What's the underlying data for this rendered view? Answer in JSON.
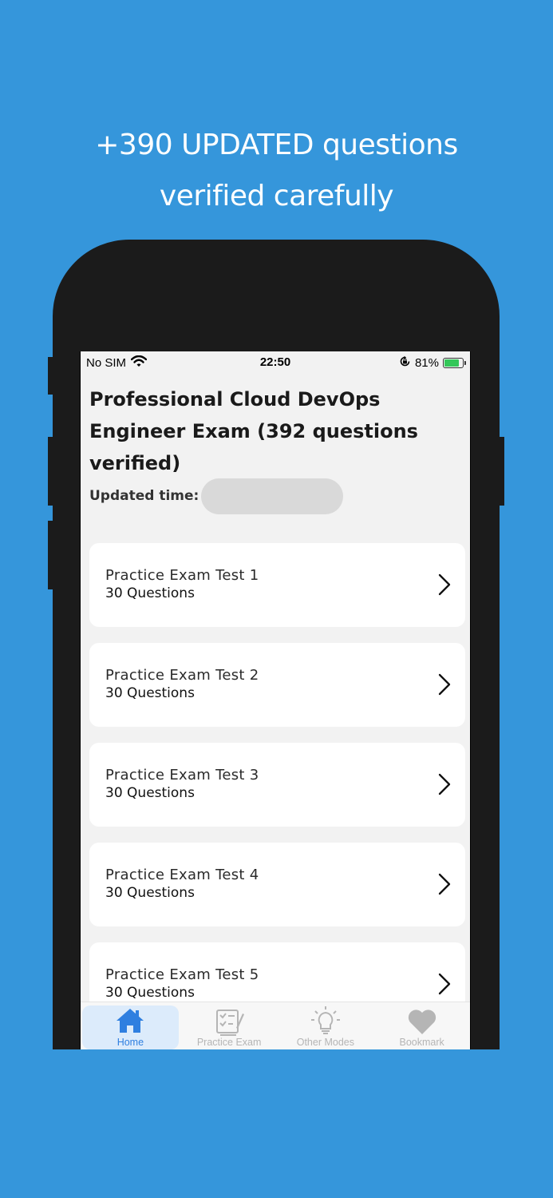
{
  "headline": "+390 UPDATED questions verified carefully",
  "status_bar": {
    "carrier": "No SIM",
    "time": "22:50",
    "battery": "81%",
    "battery_level": 0.81,
    "battery_color": "#34c759"
  },
  "page": {
    "title": "Professional Cloud DevOps Engineer Exam (392 questions verified)",
    "updated_label": "Updated time:"
  },
  "exams": [
    {
      "title": "Practice Exam Test 1",
      "subtitle": "30 Questions"
    },
    {
      "title": "Practice Exam Test 2",
      "subtitle": "30 Questions"
    },
    {
      "title": "Practice Exam Test 3",
      "subtitle": "30 Questions"
    },
    {
      "title": "Practice Exam Test 4",
      "subtitle": "30 Questions"
    },
    {
      "title": "Practice Exam Test 5",
      "subtitle": "30 Questions"
    }
  ],
  "tabs": [
    {
      "label": "Home",
      "icon": "home-icon",
      "active": true
    },
    {
      "label": "Practice Exam",
      "icon": "exam-icon",
      "active": false
    },
    {
      "label": "Other Modes",
      "icon": "lightbulb-icon",
      "active": false
    },
    {
      "label": "Bookmark",
      "icon": "heart-icon",
      "active": false
    }
  ],
  "colors": {
    "background": "#3596db",
    "active_tab": "#2f7fe0",
    "inactive_tab": "#b5b5b5"
  }
}
